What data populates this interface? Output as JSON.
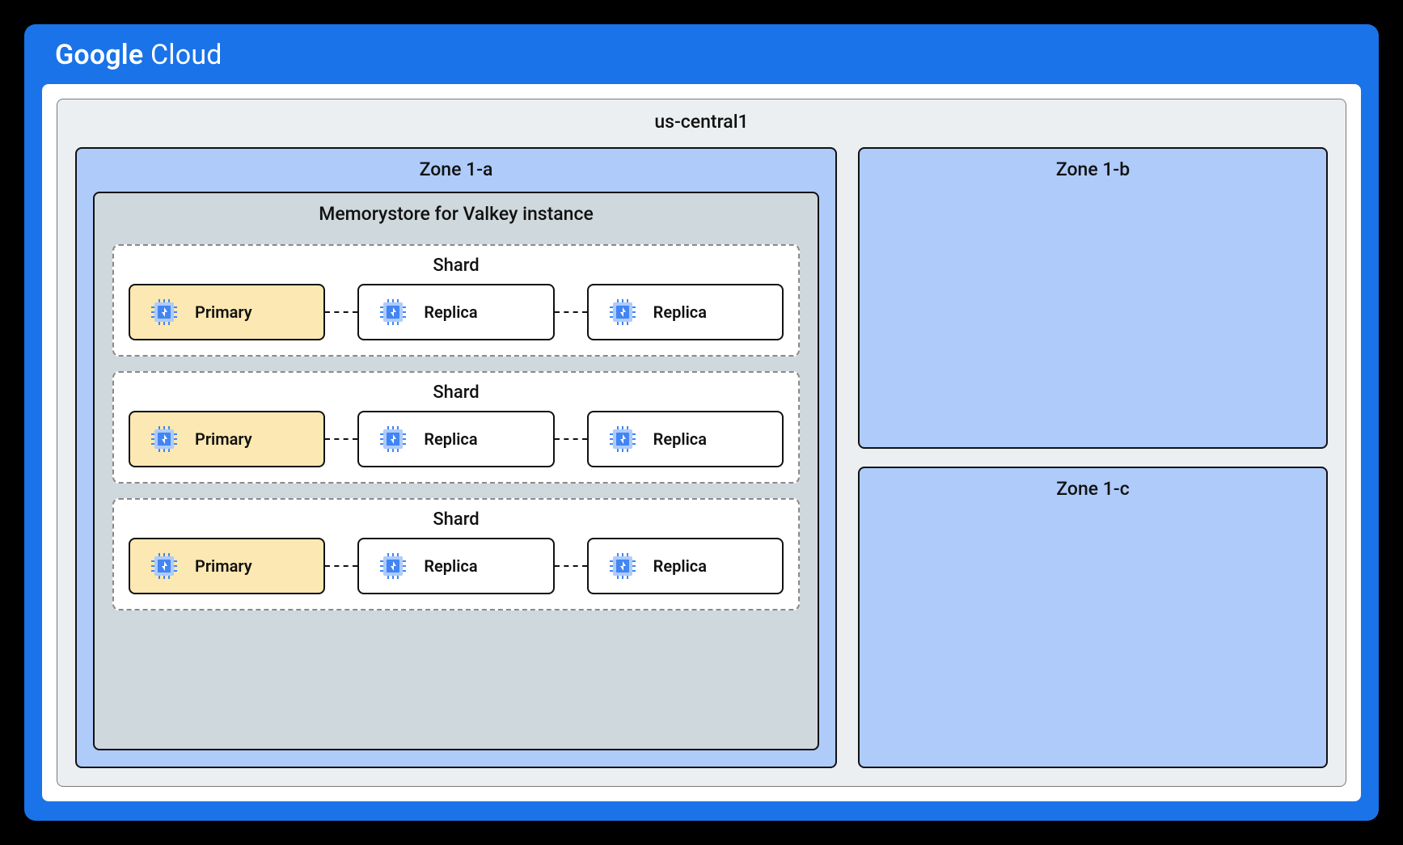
{
  "cloud": {
    "brand_bold": "Google",
    "brand_light": "Cloud"
  },
  "region": {
    "name": "us-central1"
  },
  "zones": {
    "a": {
      "label": "Zone 1-a",
      "instance": {
        "label": "Memorystore for Valkey instance",
        "shards": [
          {
            "label": "Shard",
            "nodes": [
              {
                "role": "Primary"
              },
              {
                "role": "Replica"
              },
              {
                "role": "Replica"
              }
            ]
          },
          {
            "label": "Shard",
            "nodes": [
              {
                "role": "Primary"
              },
              {
                "role": "Replica"
              },
              {
                "role": "Replica"
              }
            ]
          },
          {
            "label": "Shard",
            "nodes": [
              {
                "role": "Primary"
              },
              {
                "role": "Replica"
              },
              {
                "role": "Replica"
              }
            ]
          }
        ]
      }
    },
    "b": {
      "label": "Zone 1-b"
    },
    "c": {
      "label": "Zone 1-c"
    }
  },
  "colors": {
    "accent": "#1a73e8",
    "zone_bg": "#aecbfa",
    "instance_bg": "#cfd8dc",
    "primary_node_bg": "#fce8b2"
  }
}
